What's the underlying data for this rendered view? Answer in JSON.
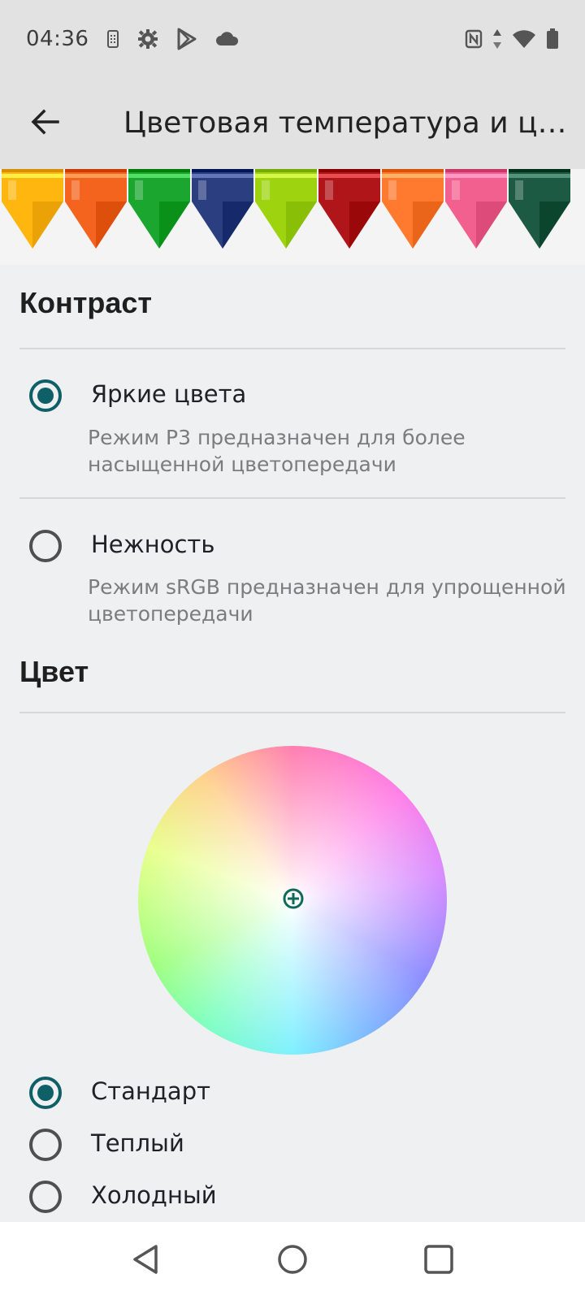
{
  "status_bar": {
    "time": "04:36",
    "icons": [
      "sim-card-icon",
      "settings-gear-icon",
      "play-store-icon",
      "cloud-icon"
    ],
    "right_icons": [
      "nfc-icon",
      "data-arrows-icon",
      "wifi-icon",
      "battery-icon"
    ]
  },
  "app_bar": {
    "back_icon": "arrow-left-icon",
    "title": "Цветовая температура и цв..."
  },
  "banner": {
    "crayon_colors": [
      "#ffb70f",
      "#f4641e",
      "#1aa62f",
      "#2b3f80",
      "#9ed40f",
      "#b0151a",
      "#ff7a2e",
      "#f2608f",
      "#1d5a43"
    ]
  },
  "contrast": {
    "title": "Контраст",
    "options": [
      {
        "label": "Яркие цвета",
        "description": "Режим P3 предназначен для более насыщенной цветопередачи",
        "checked": true
      },
      {
        "label": "Нежность",
        "description": "Режим sRGB предназначен для упрощенной цветопередачи",
        "checked": false
      }
    ]
  },
  "color": {
    "title": "Цвет",
    "wheel_icon": "color-wheel",
    "handle_icon": "crosshair-plus-icon",
    "options": [
      {
        "label": "Стандарт",
        "checked": true
      },
      {
        "label": "Теплый",
        "checked": false
      },
      {
        "label": "Холодный",
        "checked": false
      }
    ]
  },
  "nav_bar": {
    "icons": [
      "back-triangle-icon",
      "home-circle-icon",
      "recents-square-icon"
    ]
  },
  "colors": {
    "accent": "#0f5f66",
    "background": "#eff0f1",
    "app_bar": "#e2e2e2"
  }
}
